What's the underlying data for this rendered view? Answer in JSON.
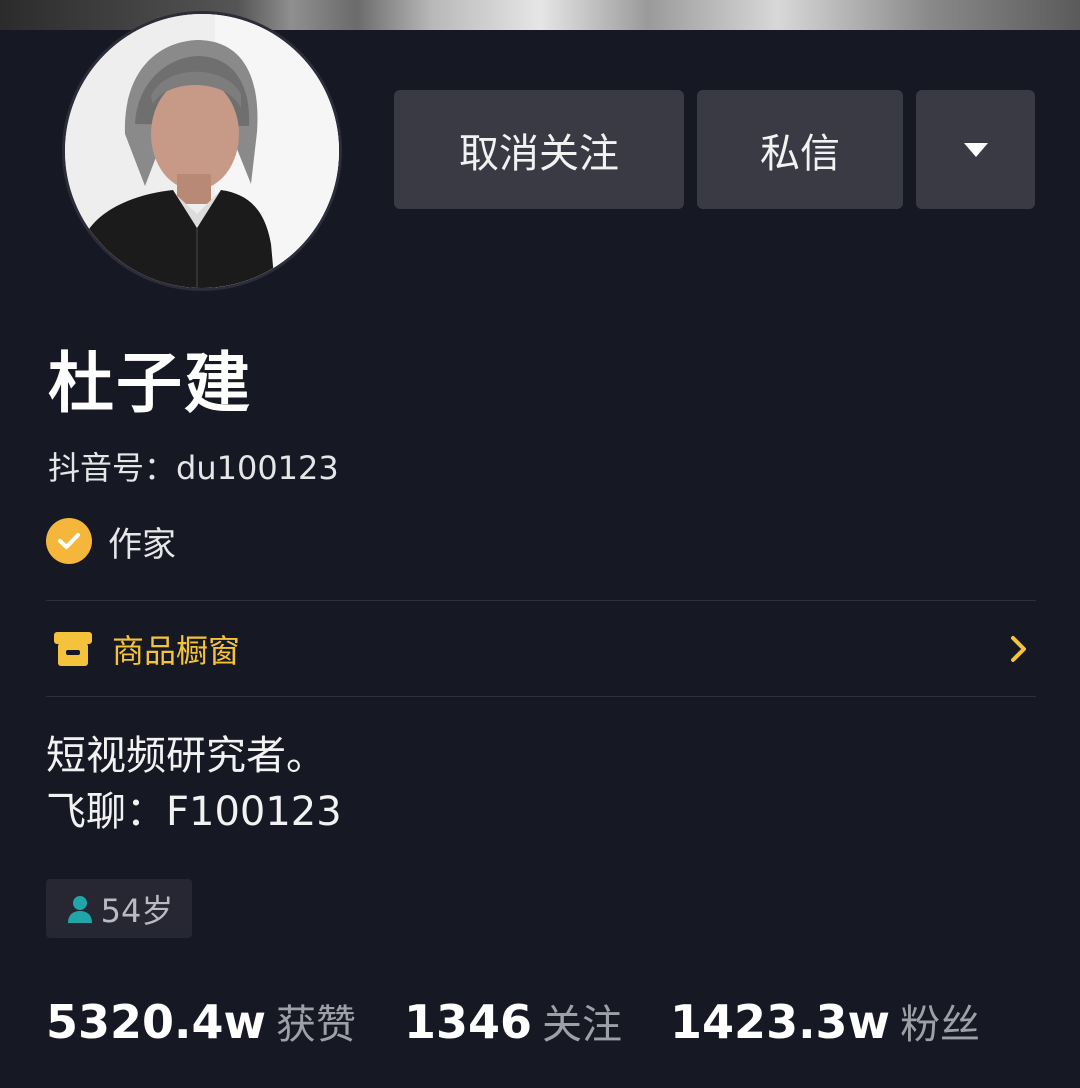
{
  "profile": {
    "name": "杜子建",
    "douyin_id": "抖音号：du100123",
    "verification": "作家",
    "age": "54岁"
  },
  "actions": {
    "unfollow_label": "取消关注",
    "message_label": "私信",
    "more_icon": "caret-down-icon"
  },
  "shop": {
    "label": "商品橱窗",
    "icon": "shop-icon"
  },
  "bio": {
    "line1": "短视频研究者。",
    "line2": "飞聊：F100123"
  },
  "stats": [
    {
      "value": "5320.4w",
      "label": "获赞"
    },
    {
      "value": "1346",
      "label": "关注"
    },
    {
      "value": "1423.3w",
      "label": "粉丝"
    }
  ],
  "colors": {
    "background": "#161823",
    "button": "#393a44",
    "accent_gold": "#f4c33b",
    "badge_orange": "#f5b73b",
    "age_icon": "#20a5a8"
  }
}
